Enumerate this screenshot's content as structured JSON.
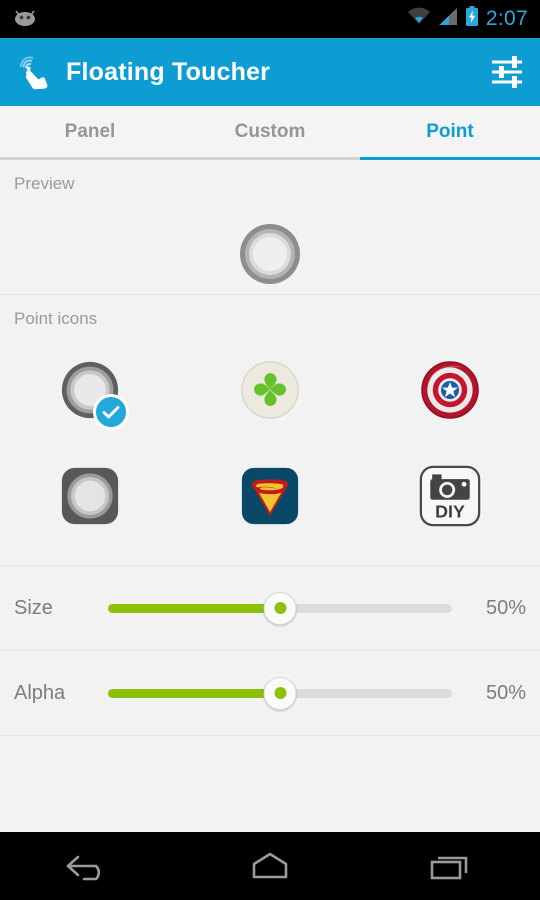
{
  "statusbar": {
    "android_icon": "android-robot-icon",
    "wifi_icon": "wifi-icon",
    "signal_icon": "cellular-signal-icon",
    "battery_icon": "battery-charging-icon",
    "time": "2:07",
    "time_color": "#2aa8d8",
    "background": "#000000"
  },
  "actionbar": {
    "logo_icon": "touch-hand-icon",
    "title": "Floating Toucher",
    "settings_icon": "sliders-settings-icon",
    "background": "#0d9dd3",
    "title_color": "#ffffff"
  },
  "tabs": {
    "active_color": "#0d9dd3",
    "inactive_color": "#969696",
    "items": [
      {
        "label": "Panel",
        "active": false
      },
      {
        "label": "Custom",
        "active": false
      },
      {
        "label": "Point",
        "active": true
      }
    ]
  },
  "preview": {
    "label": "Preview",
    "icon": "concentric-ring-point-icon"
  },
  "point_icons": {
    "label": "Point icons",
    "selected_index": 0,
    "check_badge_color": "#22a8dd",
    "items": [
      {
        "name": "ring-point-icon",
        "selected": true
      },
      {
        "name": "clover-point-icon",
        "selected": false
      },
      {
        "name": "captain-america-point-icon",
        "selected": false
      },
      {
        "name": "rounded-square-ring-icon",
        "selected": false
      },
      {
        "name": "superman-point-icon",
        "selected": false
      },
      {
        "name": "diy-camera-point-icon",
        "selected": false,
        "text": "DIY"
      }
    ]
  },
  "sliders": [
    {
      "label": "Size",
      "value": 50,
      "value_text": "50%",
      "min": 0,
      "max": 100,
      "fill_color": "#8cc00a",
      "track_color": "#dcdcdc"
    },
    {
      "label": "Alpha",
      "value": 50,
      "value_text": "50%",
      "min": 0,
      "max": 100,
      "fill_color": "#8cc00a",
      "track_color": "#dcdcdc"
    }
  ],
  "navbar": {
    "background": "#000000",
    "buttons": [
      {
        "name": "back-nav-icon"
      },
      {
        "name": "home-nav-icon"
      },
      {
        "name": "recents-nav-icon"
      }
    ]
  },
  "theme": {
    "page_background": "#f2f2f2",
    "divider": "#e2e2e2"
  }
}
